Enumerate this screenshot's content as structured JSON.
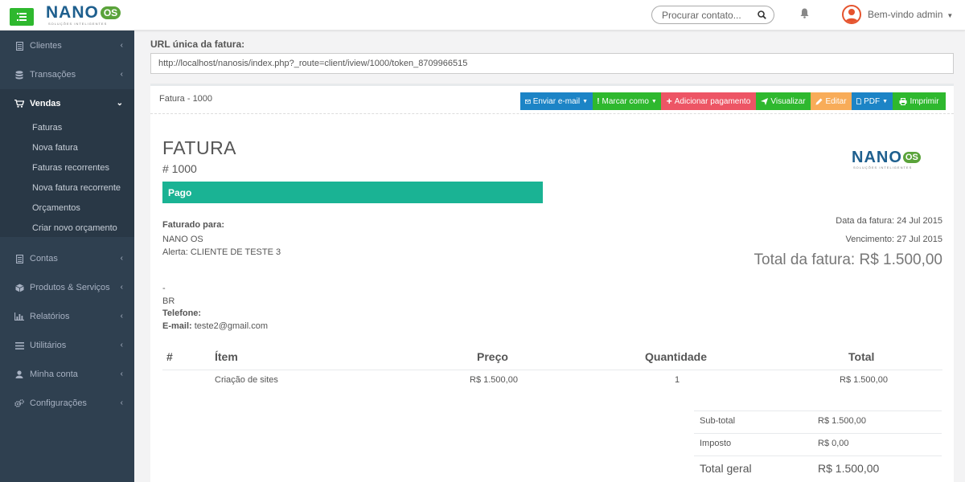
{
  "topbar": {
    "logo_main": "NANO",
    "logo_badge": "OS",
    "logo_tagline": "SOLUÇÕES INTELIGENTES",
    "search_placeholder": "Procurar contato...",
    "welcome": "Bem-vindo admin"
  },
  "sidebar": {
    "items": [
      {
        "label": "Clientes",
        "icon": "file-icon"
      },
      {
        "label": "Transações",
        "icon": "database-icon"
      },
      {
        "label": "Vendas",
        "icon": "cart-icon"
      },
      {
        "label": "Contas",
        "icon": "file-icon"
      },
      {
        "label": "Produtos & Serviços",
        "icon": "cube-icon"
      },
      {
        "label": "Relatórios",
        "icon": "bar-chart-icon"
      },
      {
        "label": "Utilitários",
        "icon": "list-icon"
      },
      {
        "label": "Minha conta",
        "icon": "user-icon"
      },
      {
        "label": "Configurações",
        "icon": "cogs-icon"
      }
    ],
    "sales_submenu": [
      "Faturas",
      "Nova fatura",
      "Faturas recorrentes",
      "Nova fatura recorrente",
      "Orçamentos",
      "Criar novo orçamento"
    ]
  },
  "url": {
    "label": "URL única da fatura:",
    "value": "http://localhost/nanosis/index.php?_route=client/iview/1000/token_8709966515"
  },
  "panel": {
    "title": "Fatura - 1000",
    "buttons": [
      {
        "label": "Enviar e-mail",
        "color": "#1c84c6"
      },
      {
        "label": "Marcar como",
        "color": "#2eb82e"
      },
      {
        "label": "Adicionar pagamento",
        "color": "#ed5565"
      },
      {
        "label": "Visualizar",
        "color": "#2eb82e"
      },
      {
        "label": "Editar",
        "color": "#f8ac59"
      },
      {
        "label": "PDF",
        "color": "#1c84c6"
      },
      {
        "label": "Imprimir",
        "color": "#2eb82e"
      }
    ]
  },
  "invoice": {
    "heading": "FATURA",
    "number": "# 1000",
    "status": "Pago",
    "status_color": "#1ab394",
    "logo_main": "NANO",
    "logo_badge": "OS",
    "logo_tagline": "SOLUÇÕES INTELIGENTES",
    "billed_to_label": "Faturado para:",
    "client_name": "NANO OS",
    "client_alert": "Alerta: CLIENTE DE TESTE 3",
    "dash": "-",
    "country": "BR",
    "phone_label": "Telefone:",
    "email_label": "E-mail:",
    "email": "teste2@gmail.com",
    "invoice_date": "Data da fatura: 24 Jul 2015",
    "due_date": "Vencimento: 27 Jul 2015",
    "total_label": "Total da fatura: R$ 1.500,00"
  },
  "items_table": {
    "headers": [
      "#",
      "Ítem",
      "Preço",
      "Quantidade",
      "Total"
    ],
    "rows": [
      {
        "item": "Criação de sites",
        "price": "R$ 1.500,00",
        "qty": "1",
        "total": "R$ 1.500,00"
      }
    ]
  },
  "summary": {
    "subtotal_label": "Sub-total",
    "subtotal": "R$ 1.500,00",
    "tax_label": "Imposto",
    "tax": "R$ 0,00",
    "grand_label": "Total geral",
    "grand": "R$ 1.500,00"
  }
}
